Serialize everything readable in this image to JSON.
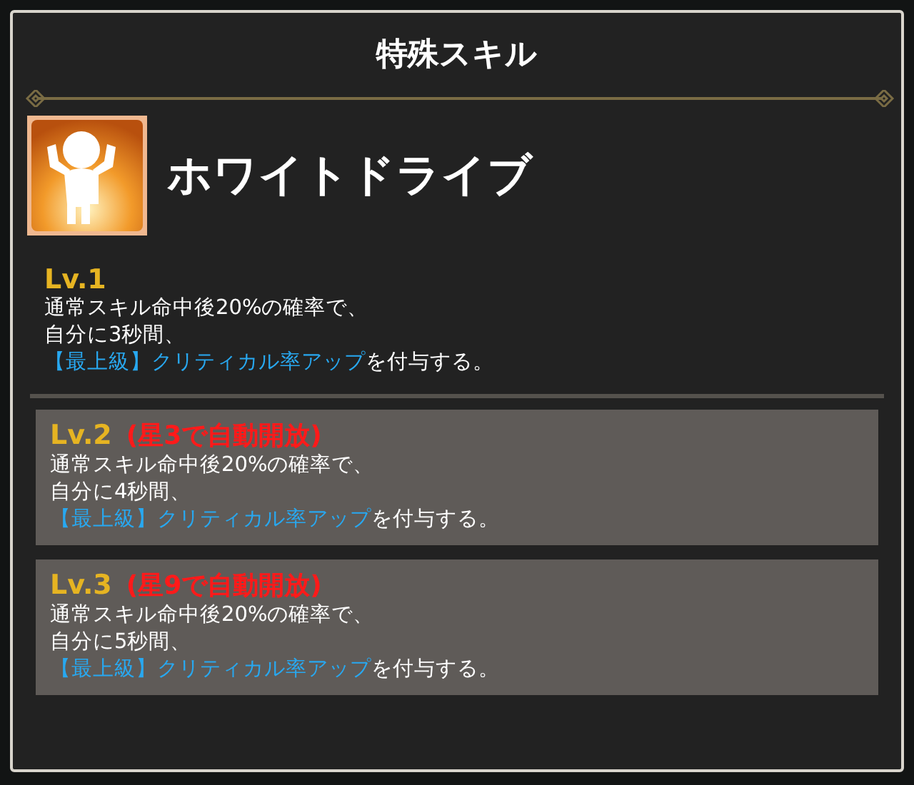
{
  "dialog": {
    "title": "特殊スキル"
  },
  "skill": {
    "name": "ホワイトドライブ"
  },
  "levels": [
    {
      "level": "Lv.1",
      "locked": false,
      "lines": [
        "通常スキル命中後20%の確率で、",
        "自分に3秒間、"
      ],
      "highlight": "【最上級】クリティカル率アップ",
      "suffix": "を付与する。"
    },
    {
      "level": "Lv.2",
      "unlock": "(星3で自動開放)",
      "locked": true,
      "lines": [
        "通常スキル命中後20%の確率で、",
        "自分に4秒間、"
      ],
      "highlight": "【最上級】クリティカル率アップ",
      "suffix": "を付与する。"
    },
    {
      "level": "Lv.3",
      "unlock": "(星9で自動開放)",
      "locked": true,
      "lines": [
        "通常スキル命中後20%の確率で、",
        "自分に5秒間、"
      ],
      "highlight": "【最上級】クリティカル率アップ",
      "suffix": "を付与する。"
    }
  ]
}
